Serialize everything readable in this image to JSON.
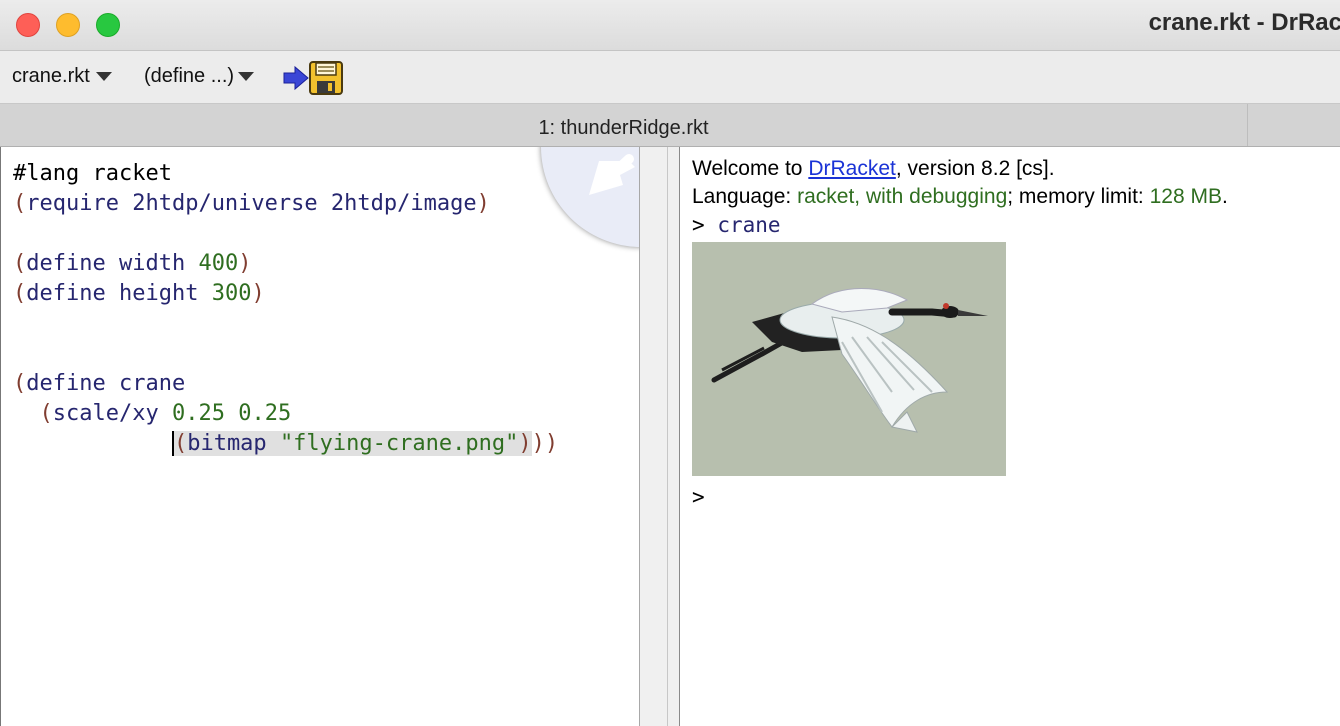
{
  "window": {
    "title": "crane.rkt - DrRac"
  },
  "toolbar": {
    "file_menu": "crane.rkt",
    "define_menu": "(define ...)"
  },
  "tab": {
    "label": "1: thunderRidge.rkt"
  },
  "editor": {
    "lang_line": "#lang racket",
    "require_kw": "require",
    "require_args": "2htdp/universe 2htdp/image",
    "define_kw": "define",
    "width_name": "width",
    "width_value": "400",
    "height_name": "height",
    "height_value": "300",
    "crane_name": "crane",
    "scale_fn": "scale/xy",
    "scale_x": "0.25",
    "scale_y": "0.25",
    "bitmap_fn": "bitmap",
    "bitmap_arg": "\"flying-crane.png\""
  },
  "repl": {
    "welcome_prefix": "Welcome to ",
    "welcome_link": "DrRacket",
    "welcome_suffix": ", version 8.2 [cs].",
    "language_label": "Language: ",
    "language_value": "racket, with debugging",
    "memory_label": "; memory limit: ",
    "memory_value": "128 MB",
    "memory_end": ".",
    "prompt": ">",
    "input": "crane",
    "image_bg": "#b7bfae"
  }
}
